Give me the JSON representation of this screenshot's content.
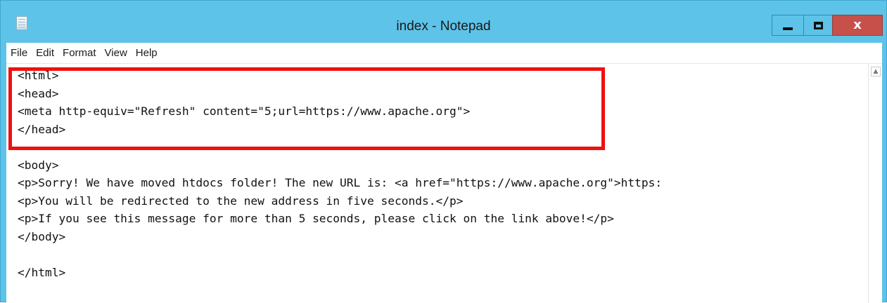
{
  "window": {
    "title": "index - Notepad",
    "controls": {
      "minimize_icon": "minimize-icon",
      "maximize_icon": "maximize-icon",
      "close_glyph": "x"
    }
  },
  "menu": {
    "items": [
      {
        "label": "File"
      },
      {
        "label": "Edit"
      },
      {
        "label": "Format"
      },
      {
        "label": "View"
      },
      {
        "label": "Help"
      }
    ]
  },
  "editor": {
    "lines": [
      "<html>",
      "<head>",
      "<meta http-equiv=\"Refresh\" content=\"5;url=https://www.apache.org\">",
      "</head>",
      "",
      "<body>",
      "<p>Sorry! We have moved htdocs folder! The new URL is: <a href=\"https://www.apache.org\">https:",
      "<p>You will be redirected to the new address in five seconds.</p>",
      "<p>If you see this message for more than 5 seconds, please click on the link above!</p>",
      "</body>",
      "",
      "</html>"
    ]
  },
  "annotation": {
    "highlight_color": "#ee1111"
  },
  "colors": {
    "titlebar": "#5ec3e8",
    "close_button": "#c7504b"
  }
}
